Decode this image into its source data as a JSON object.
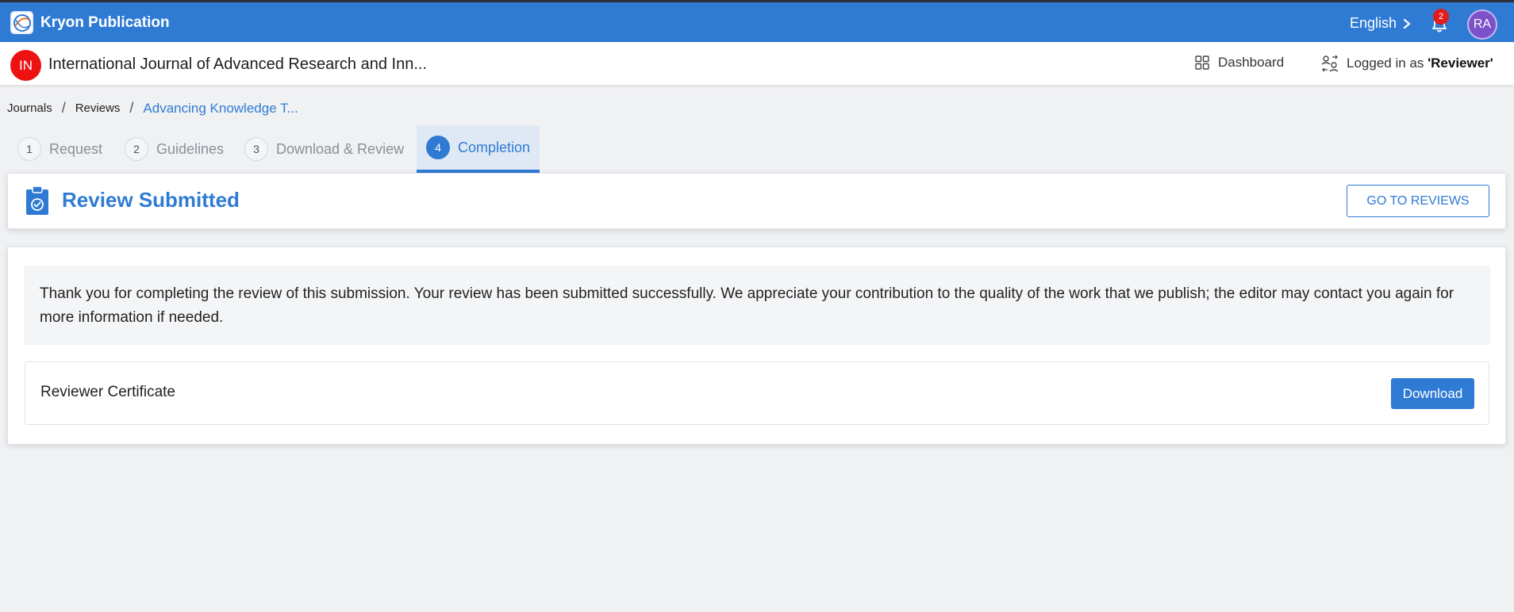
{
  "topbar": {
    "brand": "Kryon Publication",
    "language": "English",
    "notification_count": "2",
    "avatar_initials": "RA"
  },
  "journal": {
    "badge": "IN",
    "title": "International Journal of Advanced Research and Inn...",
    "dashboard_label": "Dashboard",
    "logged_prefix": "Logged in as ",
    "logged_role": "'Reviewer'"
  },
  "breadcrumb": {
    "items": [
      "Journals",
      "Reviews"
    ],
    "current": "Advancing Knowledge T..."
  },
  "steps": [
    {
      "num": "1",
      "label": "Request"
    },
    {
      "num": "2",
      "label": "Guidelines"
    },
    {
      "num": "3",
      "label": "Download & Review"
    },
    {
      "num": "4",
      "label": "Completion"
    }
  ],
  "header_card": {
    "title": "Review Submitted",
    "button": "GO TO REVIEWS"
  },
  "main": {
    "message": "Thank you for completing the review of this submission. Your review has been submitted successfully. We appreciate your contribution to the quality of the work that we publish; the editor may contact you again for more information if needed.",
    "certificate_label": "Reviewer Certificate",
    "download_button": "Download"
  },
  "colors": {
    "primary": "#2f7bd4",
    "journal_badge": "#ee1111",
    "avatar": "#7b52c9",
    "badge_red": "#e21b1b"
  }
}
